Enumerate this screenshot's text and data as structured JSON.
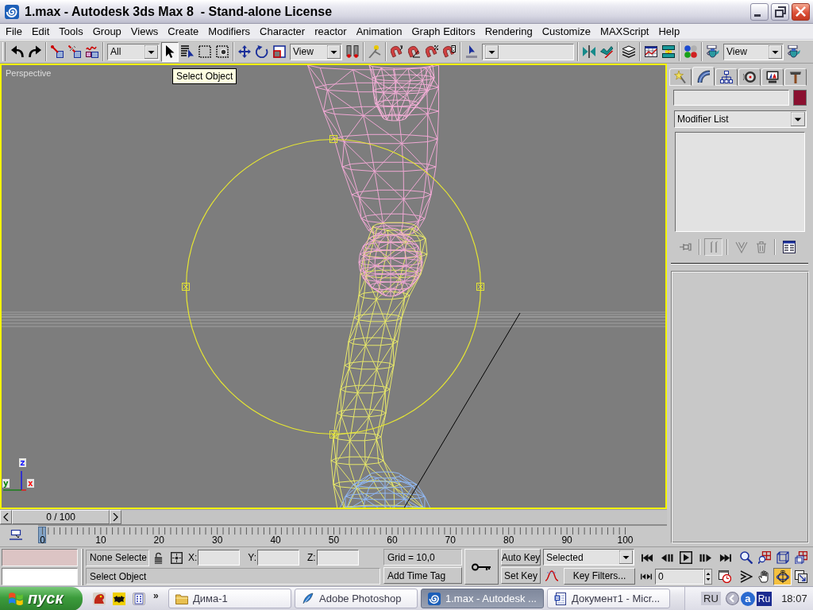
{
  "window": {
    "title": "1.max - Autodesk 3ds Max 8  - Stand-alone License"
  },
  "menu": [
    "File",
    "Edit",
    "Tools",
    "Group",
    "Views",
    "Create",
    "Modifiers",
    "Character",
    "reactor",
    "Animation",
    "Graph Editors",
    "Rendering",
    "Customize",
    "MAXScript",
    "Help"
  ],
  "toolbar": {
    "groups": [
      {
        "items": [
          {
            "kind": "undo",
            "selected": false
          },
          {
            "kind": "redo",
            "selected": false
          }
        ]
      },
      {
        "items": [
          {
            "kind": "link",
            "selected": false
          },
          {
            "kind": "unlink",
            "selected": false
          },
          {
            "kind": "bind",
            "selected": false
          }
        ]
      },
      {
        "items": [
          {
            "kind": "dropdown",
            "value": "All"
          },
          {
            "kind": "select",
            "selected": true
          },
          {
            "kind": "byname",
            "selected": false
          },
          {
            "kind": "region",
            "selected": false
          },
          {
            "kind": "crossing",
            "selected": false
          }
        ]
      },
      {
        "items": [
          {
            "kind": "move",
            "selected": false
          },
          {
            "kind": "rotate",
            "selected": false
          },
          {
            "kind": "scale",
            "selected": false
          },
          {
            "kind": "dropdown",
            "value": "View"
          },
          {
            "kind": "pivot",
            "selected": false
          }
        ]
      },
      {
        "items": [
          {
            "kind": "manipulate",
            "selected": false
          }
        ]
      },
      {
        "items": [
          {
            "kind": "snap",
            "selected": false
          },
          {
            "kind": "anglesnap",
            "selected": false
          },
          {
            "kind": "percentsnap",
            "selected": false
          },
          {
            "kind": "spinnersnap",
            "selected": false
          }
        ]
      },
      {
        "items": [
          {
            "kind": "editnamed",
            "selected": false
          },
          {
            "kind": "dropdown"
          }
        ]
      },
      {
        "items": [
          {
            "kind": "mirror",
            "selected": false
          },
          {
            "kind": "align",
            "selected": false
          }
        ]
      },
      {
        "items": [
          {
            "kind": "layers",
            "selected": false
          }
        ]
      },
      {
        "items": [
          {
            "kind": "curveeditor",
            "selected": false
          },
          {
            "kind": "schematic",
            "selected": false
          }
        ]
      },
      {
        "items": [
          {
            "kind": "material",
            "selected": false
          }
        ]
      },
      {
        "items": [
          {
            "kind": "render",
            "selected": false
          },
          {
            "kind": "dropdown",
            "value": "View"
          },
          {
            "kind": "quickrender",
            "selected": false
          }
        ]
      }
    ]
  },
  "viewport": {
    "label": "Perspective",
    "active": true,
    "tooltip": "Select Object",
    "axes": [
      {
        "label": "z",
        "color": "#0000ff"
      },
      {
        "label": "y",
        "color": "#008000"
      },
      {
        "label": "x",
        "color": "#ff0000"
      }
    ]
  },
  "command_panel": {
    "tabs": [
      {
        "kind": "create",
        "selected": false
      },
      {
        "kind": "modify",
        "selected": true
      },
      {
        "kind": "hierarchy",
        "selected": false
      },
      {
        "kind": "motion",
        "selected": false
      },
      {
        "kind": "display",
        "selected": false
      },
      {
        "kind": "utilities",
        "selected": false
      }
    ],
    "modifier_list": {
      "value": "Modifier List"
    },
    "stack_tools": [
      {
        "kind": "pin",
        "on": false,
        "disabled": true
      },
      {
        "kind": "endresult",
        "on": true,
        "disabled": true
      },
      {
        "kind": "unique",
        "on": false,
        "disabled": true
      },
      {
        "kind": "remove",
        "on": false,
        "disabled": true
      },
      {
        "kind": "configure",
        "on": false,
        "disabled": false
      }
    ]
  },
  "time_slider": {
    "label": "0 / 100",
    "level": 0
  },
  "track_bar": {
    "labels": [
      "0",
      "10",
      "20",
      "30",
      "40",
      "50",
      "60",
      "70",
      "80",
      "90",
      "100"
    ]
  },
  "status": {
    "selection": "None Selecte",
    "coords": [
      {
        "label": "X:"
      },
      {
        "label": "Y:"
      },
      {
        "label": "Z:"
      }
    ],
    "prompt": "Select Object",
    "grid": "Grid = 10,0",
    "time_tag": "Add Time Tag"
  },
  "animation": {
    "auto_key": {
      "label": "Auto Key",
      "on": false
    },
    "set_key": "Set Key",
    "key_filter_mode": {
      "value": "Selected"
    },
    "key_filters": "Key Filters...",
    "frame": {
      "value": "0"
    }
  },
  "navigation": [
    {
      "kind": "zoom",
      "selected": false
    },
    {
      "kind": "zoomall",
      "selected": false
    },
    {
      "kind": "extents",
      "selected": false
    },
    {
      "kind": "extentsall",
      "selected": false
    },
    {
      "kind": "fov",
      "selected": false
    },
    {
      "kind": "pan",
      "selected": false
    },
    {
      "kind": "orbit",
      "selected": true
    },
    {
      "kind": "maximize",
      "selected": false
    }
  ],
  "taskbar": {
    "start": "пуск",
    "more": "»",
    "tasks": [
      {
        "kind": "folder",
        "label": "Дима-1",
        "selected": false
      },
      {
        "kind": "feather",
        "label": "Adobe Photoshop",
        "selected": false
      },
      {
        "kind": "swirl",
        "label": "1.max - Autodesk ...",
        "selected": true
      },
      {
        "kind": "document",
        "label": "Документ1 - Micr...",
        "selected": false
      }
    ],
    "language": "RU",
    "tray_buttons": [
      "a",
      "Ru"
    ],
    "clock": "18:07"
  }
}
